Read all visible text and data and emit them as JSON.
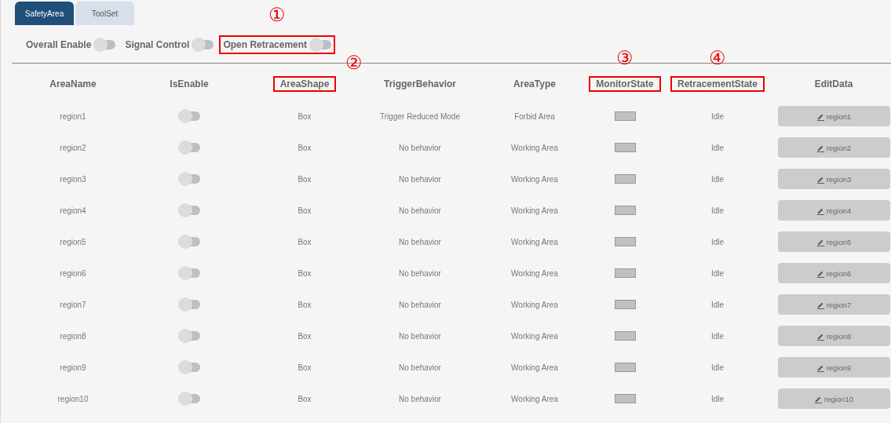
{
  "tabs": [
    {
      "label": "SafetyArea",
      "selected": true
    },
    {
      "label": "ToolSet",
      "selected": false
    }
  ],
  "switches": [
    {
      "label": "Overall Enable",
      "on": false,
      "highlighted": false
    },
    {
      "label": "Signal Control",
      "on": false,
      "highlighted": false
    },
    {
      "label": "Open Retracement",
      "on": false,
      "highlighted": true,
      "marker": "①"
    }
  ],
  "table": {
    "columns": [
      {
        "label": "AreaName",
        "highlighted": false
      },
      {
        "label": "IsEnable",
        "highlighted": false
      },
      {
        "label": "AreaShape",
        "highlighted": true,
        "marker": "②"
      },
      {
        "label": "TriggerBehavior",
        "highlighted": false
      },
      {
        "label": "AreaType",
        "highlighted": false
      },
      {
        "label": "MonitorState",
        "highlighted": true,
        "marker": "③"
      },
      {
        "label": "RetracementState",
        "highlighted": true,
        "marker": "④"
      },
      {
        "label": "EditData",
        "highlighted": false
      }
    ],
    "rows": [
      {
        "name": "region1",
        "enabled": false,
        "shape": "Box",
        "behavior": "Trigger Reduced Mode",
        "type": "Forbid Area",
        "monitor_active": false,
        "retracement": "Idle",
        "edit": "region1"
      },
      {
        "name": "region2",
        "enabled": false,
        "shape": "Box",
        "behavior": "No behavior",
        "type": "Working Area",
        "monitor_active": false,
        "retracement": "Idle",
        "edit": "region2"
      },
      {
        "name": "region3",
        "enabled": false,
        "shape": "Box",
        "behavior": "No behavior",
        "type": "Working Area",
        "monitor_active": false,
        "retracement": "Idle",
        "edit": "region3"
      },
      {
        "name": "region4",
        "enabled": false,
        "shape": "Box",
        "behavior": "No behavior",
        "type": "Working Area",
        "monitor_active": false,
        "retracement": "Idle",
        "edit": "region4"
      },
      {
        "name": "region5",
        "enabled": false,
        "shape": "Box",
        "behavior": "No behavior",
        "type": "Working Area",
        "monitor_active": false,
        "retracement": "Idle",
        "edit": "region5"
      },
      {
        "name": "region6",
        "enabled": false,
        "shape": "Box",
        "behavior": "No behavior",
        "type": "Working Area",
        "monitor_active": false,
        "retracement": "Idle",
        "edit": "region6"
      },
      {
        "name": "region7",
        "enabled": false,
        "shape": "Box",
        "behavior": "No behavior",
        "type": "Working Area",
        "monitor_active": false,
        "retracement": "Idle",
        "edit": "region7"
      },
      {
        "name": "region8",
        "enabled": false,
        "shape": "Box",
        "behavior": "No behavior",
        "type": "Working Area",
        "monitor_active": false,
        "retracement": "Idle",
        "edit": "region8"
      },
      {
        "name": "region9",
        "enabled": false,
        "shape": "Box",
        "behavior": "No behavior",
        "type": "Working Area",
        "monitor_active": false,
        "retracement": "Idle",
        "edit": "region9"
      },
      {
        "name": "region10",
        "enabled": false,
        "shape": "Box",
        "behavior": "No behavior",
        "type": "Working Area",
        "monitor_active": false,
        "retracement": "Idle",
        "edit": "region10"
      }
    ]
  }
}
